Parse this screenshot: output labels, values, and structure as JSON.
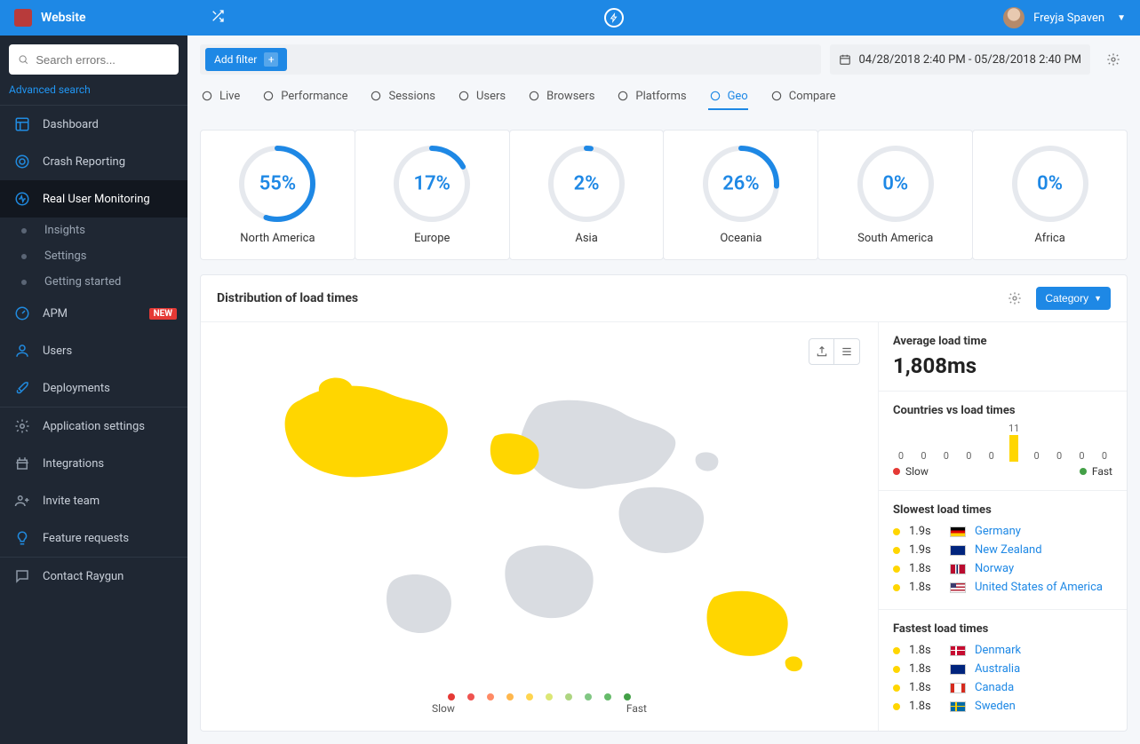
{
  "header": {
    "site": "Website",
    "user": "Freyja Spaven"
  },
  "search": {
    "placeholder": "Search errors...",
    "advanced": "Advanced search"
  },
  "sidebar": {
    "dashboard": "Dashboard",
    "crash": "Crash Reporting",
    "rum": "Real User Monitoring",
    "subs": [
      "Insights",
      "Settings",
      "Getting started"
    ],
    "apm": "APM",
    "apm_badge": "NEW",
    "users": "Users",
    "deployments": "Deployments",
    "appsettings": "Application settings",
    "integrations": "Integrations",
    "invite": "Invite team",
    "feature": "Feature requests",
    "contact": "Contact Raygun"
  },
  "filter": {
    "add": "Add filter",
    "date": "04/28/2018 2:40 PM - 05/28/2018 2:40 PM"
  },
  "tabs": [
    "Live",
    "Performance",
    "Sessions",
    "Users",
    "Browsers",
    "Platforms",
    "Geo",
    "Compare"
  ],
  "active_tab": 6,
  "gauges": [
    {
      "label": "North America",
      "pct": 55
    },
    {
      "label": "Europe",
      "pct": 17
    },
    {
      "label": "Asia",
      "pct": 2
    },
    {
      "label": "Oceania",
      "pct": 26
    },
    {
      "label": "South America",
      "pct": 0
    },
    {
      "label": "Africa",
      "pct": 0
    }
  ],
  "panel": {
    "title": "Distribution of load times",
    "category_btn": "Category",
    "avg_title": "Average load time",
    "avg_value": "1,808ms",
    "hist_title": "Countries vs load times",
    "hist_values": [
      0,
      0,
      0,
      0,
      0,
      11,
      0,
      0,
      0,
      0
    ],
    "slow": "Slow",
    "fast": "Fast",
    "slowest_title": "Slowest load times",
    "slowest": [
      {
        "t": "1.9s",
        "flag": "de",
        "c": "Germany"
      },
      {
        "t": "1.9s",
        "flag": "nz",
        "c": "New Zealand"
      },
      {
        "t": "1.8s",
        "flag": "no",
        "c": "Norway"
      },
      {
        "t": "1.8s",
        "flag": "us",
        "c": "United States of America"
      }
    ],
    "fastest_title": "Fastest load times",
    "fastest": [
      {
        "t": "1.8s",
        "flag": "dk",
        "c": "Denmark"
      },
      {
        "t": "1.8s",
        "flag": "au",
        "c": "Australia"
      },
      {
        "t": "1.8s",
        "flag": "ca",
        "c": "Canada"
      },
      {
        "t": "1.8s",
        "flag": "se",
        "c": "Sweden"
      }
    ],
    "legend_colors": [
      "#e53935",
      "#ef5350",
      "#ff8a65",
      "#ffb74d",
      "#ffd54f",
      "#dce775",
      "#aed581",
      "#81c784",
      "#66bb6a",
      "#43a047"
    ]
  },
  "chart_data": {
    "type": "bar",
    "title": "Countries vs load times",
    "categories": [
      "b1",
      "b2",
      "b3",
      "b4",
      "b5",
      "b6",
      "b7",
      "b8",
      "b9",
      "b10"
    ],
    "values": [
      0,
      0,
      0,
      0,
      0,
      11,
      0,
      0,
      0,
      0
    ],
    "xlabel_left": "Slow",
    "xlabel_right": "Fast"
  }
}
